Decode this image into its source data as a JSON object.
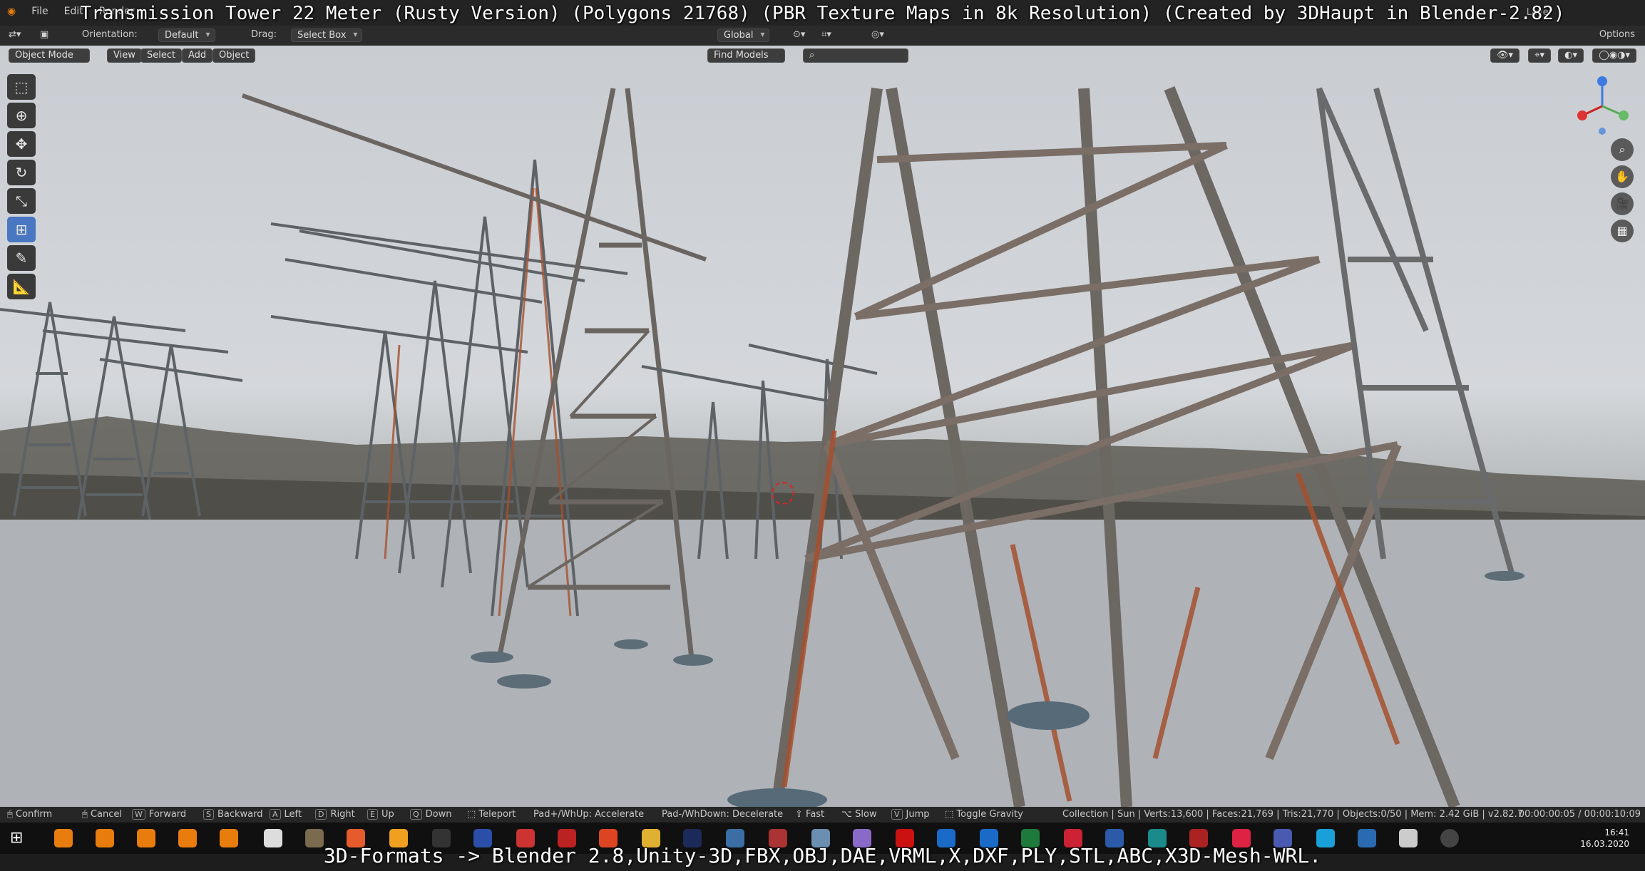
{
  "title_overlay": "Transmission Tower 22 Meter (Rusty Version) (Polygons 21768) (PBR Texture Maps in 8k Resolution) (Created by 3DHaupt in Blender-2.82)",
  "menu": [
    "File",
    "Edit",
    "Render"
  ],
  "top_right": {
    "layer_label": "Layer"
  },
  "toolbar": {
    "orientation_label": "Orientation:",
    "orientation_value": "Default",
    "drag_label": "Drag:",
    "drag_value": "Select Box",
    "transform_value": "Global",
    "options_label": "Options"
  },
  "viewport_header": {
    "mode": "Object Mode",
    "view": "View",
    "select": "Select",
    "add": "Add",
    "object": "Object",
    "find_models": "Find Models"
  },
  "statusbar": {
    "items": [
      {
        "key": "",
        "label": "Confirm"
      },
      {
        "key": "",
        "label": "Cancel"
      },
      {
        "key": "W",
        "label": "Forward"
      },
      {
        "key": "S",
        "label": "Backward"
      },
      {
        "key": "A",
        "label": "Left"
      },
      {
        "key": "D",
        "label": "Right"
      },
      {
        "key": "E",
        "label": "Up"
      },
      {
        "key": "Q",
        "label": "Down"
      },
      {
        "key": "",
        "label": "Teleport"
      },
      {
        "key": "",
        "label": "Pad+/WhUp: Accelerate"
      },
      {
        "key": "",
        "label": "Pad-/WhDown: Decelerate"
      },
      {
        "key": "",
        "label": "Fast"
      },
      {
        "key": "",
        "label": "Slow"
      },
      {
        "key": "V",
        "label": "Jump"
      },
      {
        "key": "",
        "label": "Toggle Gravity"
      }
    ],
    "scene_info": "Collection | Sun | Verts:13,600 | Faces:21,769 | Tris:21,770 | Objects:0/50 | Mem: 2.42 GiB | v2.82.7",
    "timecode": "00:00:00:05 / 00:00:10:09"
  },
  "taskbar": {
    "time": "16:41",
    "date": "16.03.2020"
  },
  "caption": "3D-Formats -> Blender 2.8,Unity-3D,FBX,OBJ,DAE,VRML,X,DXF,PLY,STL,ABC,X3D-Mesh-WRL.",
  "icons": {
    "tools": [
      "select-box-icon",
      "cursor-icon",
      "move-icon",
      "rotate-icon",
      "scale-icon",
      "transform-icon",
      "annotate-icon",
      "measure-icon"
    ],
    "nav": [
      "zoom-icon",
      "hand-pan-icon",
      "camera-icon",
      "grid-icon"
    ]
  },
  "colors": {
    "accent": "#4a77c2",
    "rust": "#a5502e",
    "steel": "#5d6266"
  }
}
